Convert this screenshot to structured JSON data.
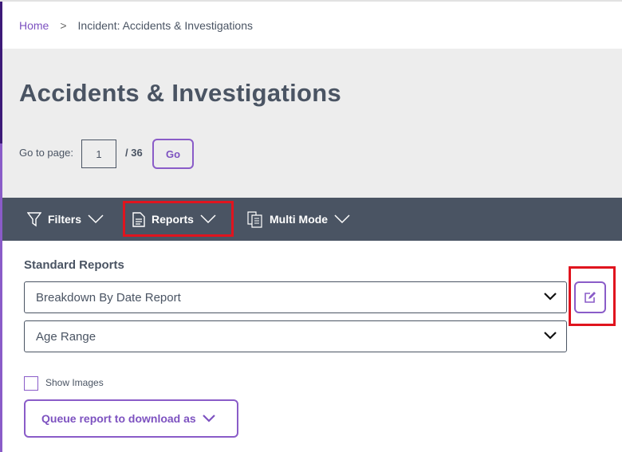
{
  "breadcrumb": {
    "home": "Home",
    "separator": ">",
    "current": "Incident: Accidents & Investigations"
  },
  "page": {
    "title": "Accidents & Investigations",
    "goto_label": "Go to page:",
    "current_page": "1",
    "total_pages": "/ 36",
    "go_label": "Go"
  },
  "toolbar": {
    "filters": "Filters",
    "reports": "Reports",
    "multi_mode": "Multi Mode"
  },
  "reports": {
    "section_title": "Standard Reports",
    "report_select": "Breakdown By Date Report",
    "field_select": "Age Range",
    "show_images": "Show Images",
    "queue_label": "Queue report to download as"
  },
  "colors": {
    "accent": "#7d52c0",
    "nav": "#4a5463",
    "highlight": "#e0141e"
  }
}
